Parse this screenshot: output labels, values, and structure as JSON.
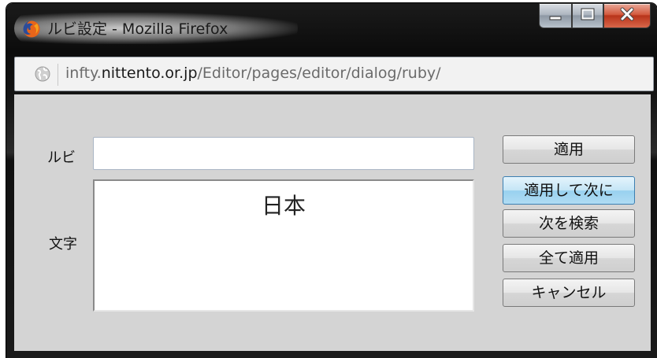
{
  "window": {
    "title": "ルビ設定 - Mozilla Firefox",
    "controls": {
      "minimize": "minimize",
      "maximize": "maximize",
      "close": "close"
    }
  },
  "addressbar": {
    "prefix": "infty.",
    "domain": "nittento.or.jp",
    "path": "/Editor/pages/editor/dialog/ruby/"
  },
  "form": {
    "ruby_label": "ルビ",
    "ruby_value": "",
    "text_label": "文字",
    "text_value": "日本"
  },
  "buttons": {
    "apply": "適用",
    "apply_next": "適用して次に",
    "find_next": "次を検索",
    "apply_all": "全て適用",
    "cancel": "キャンセル"
  },
  "icons": {
    "app": "firefox-icon",
    "site": "globe-icon"
  }
}
